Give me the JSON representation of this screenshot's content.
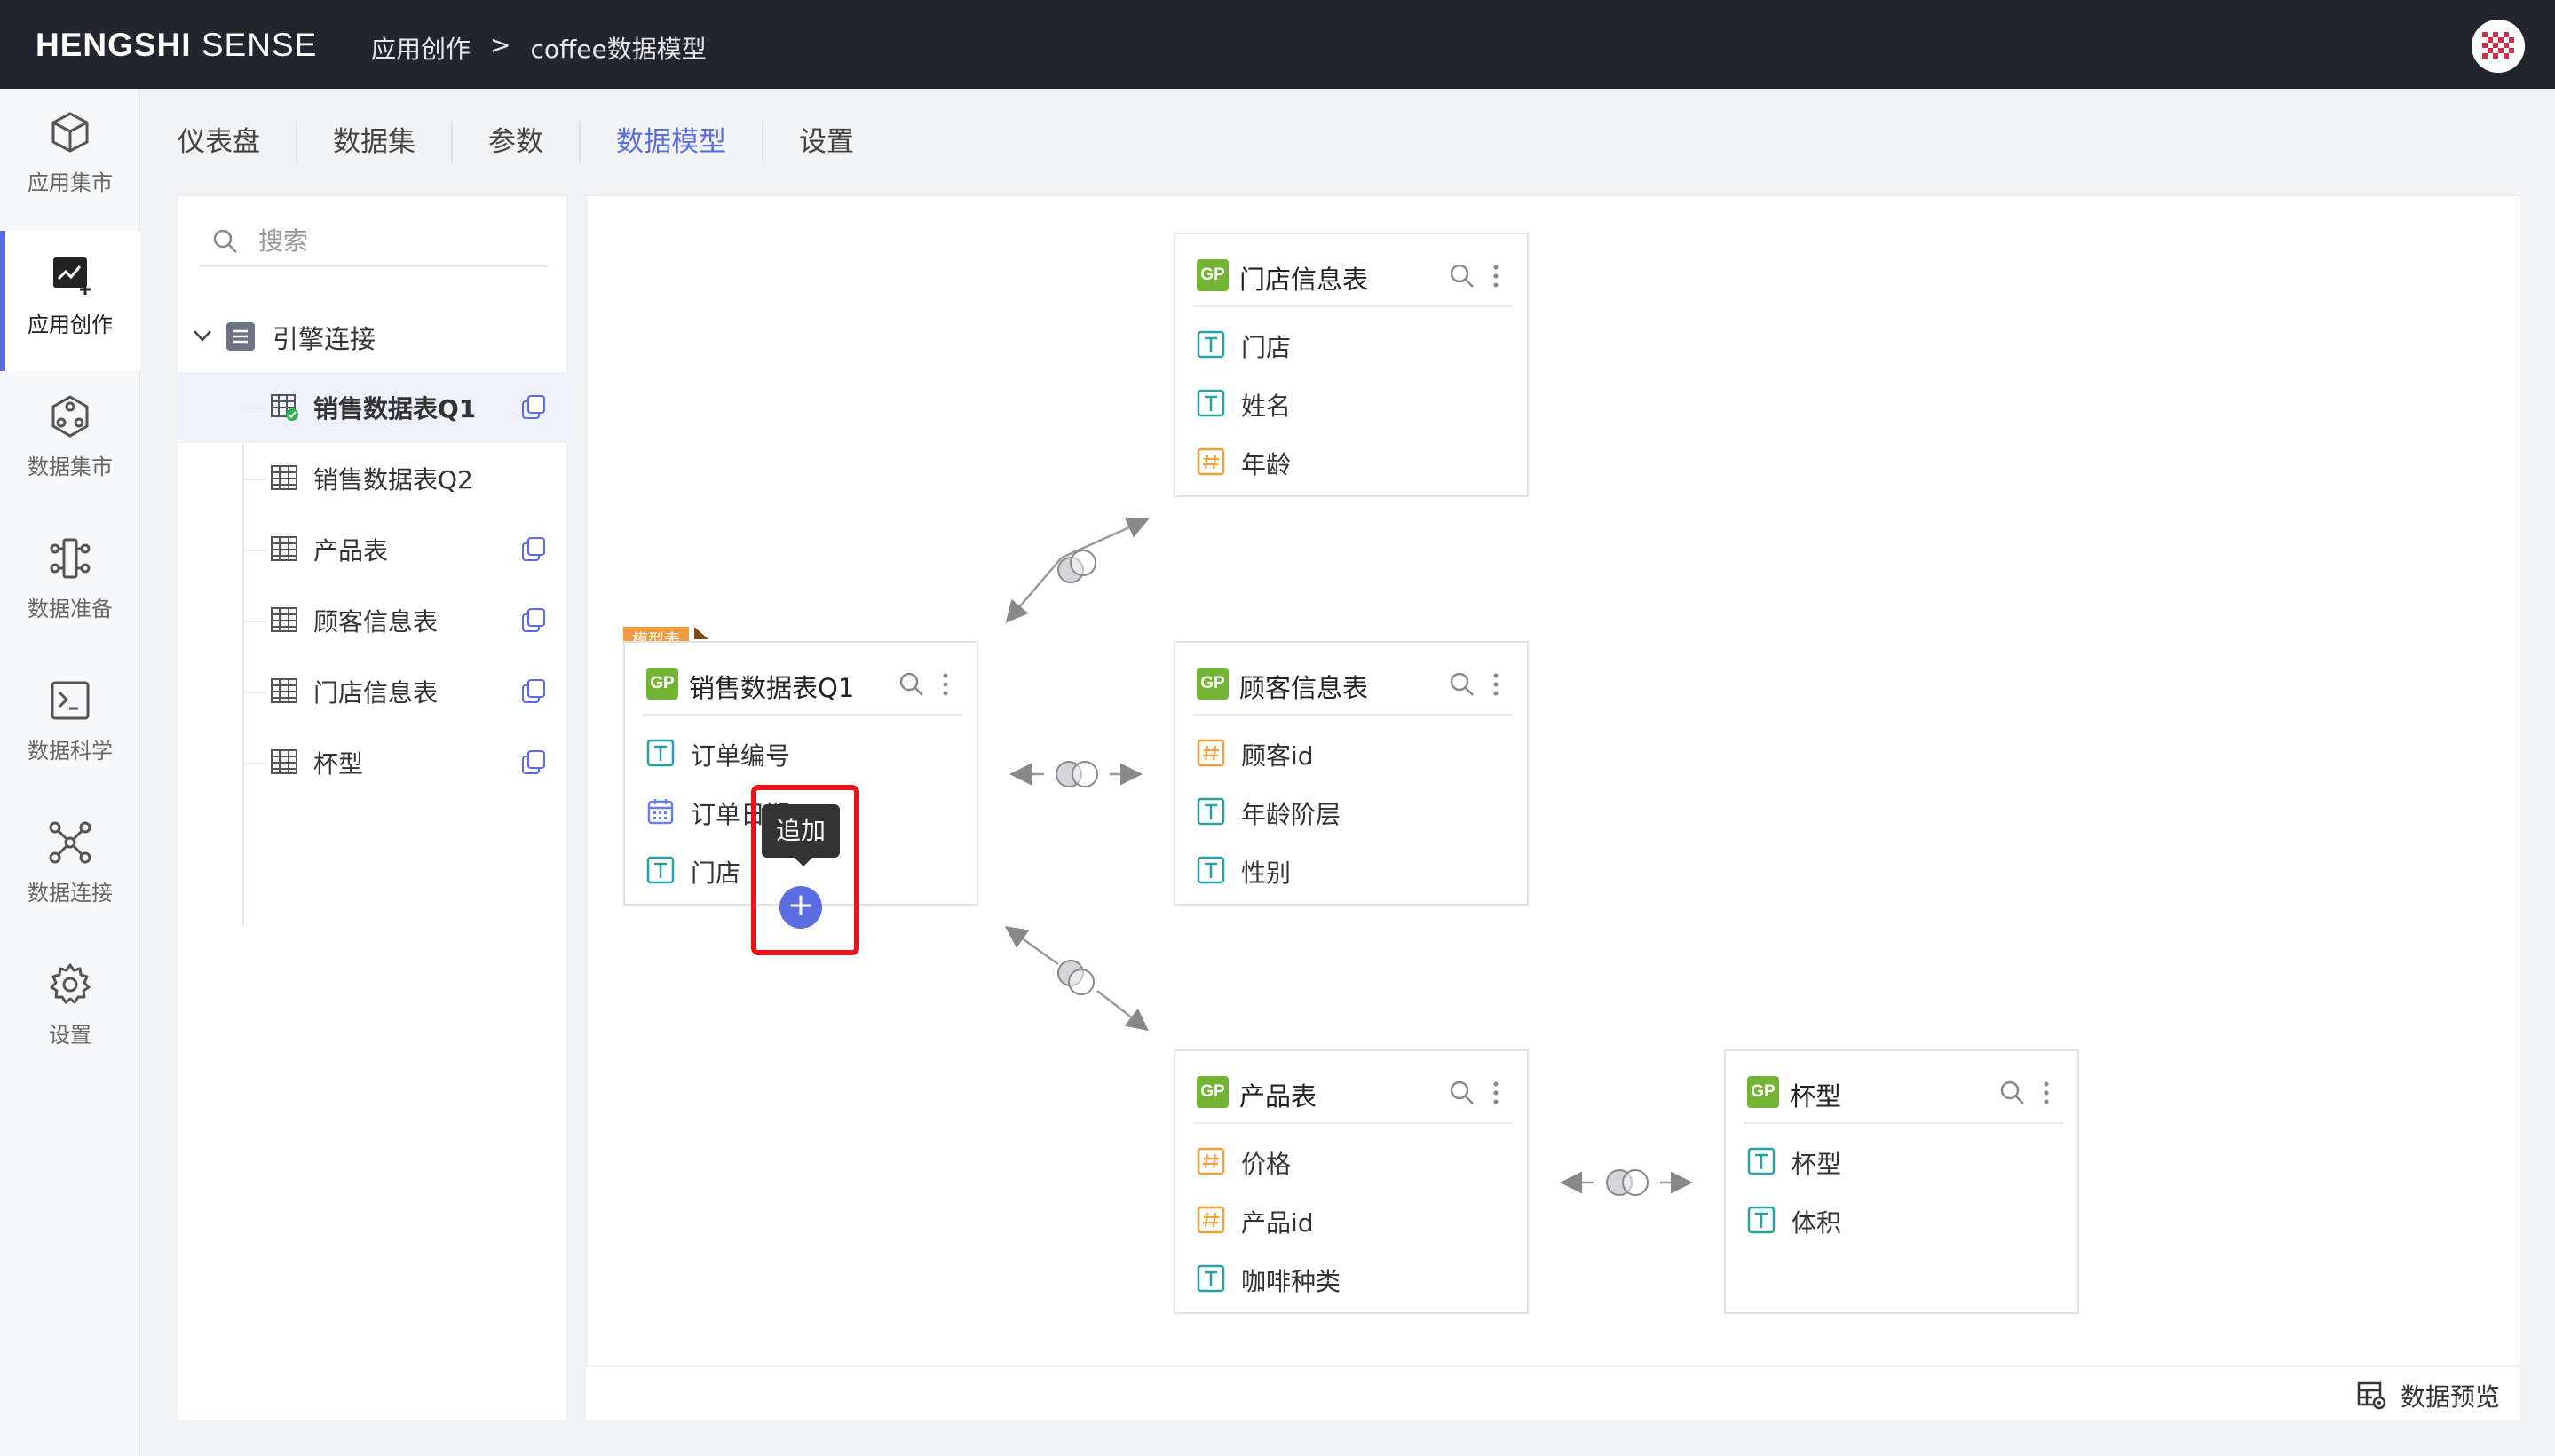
{
  "app": {
    "brand_bold": "HENGSHI",
    "brand_light": " SENSE",
    "breadcrumb": [
      "应用创作",
      ">",
      "coffee数据模型"
    ]
  },
  "leftnav": [
    {
      "label": "应用集市",
      "icon": "cube-icon"
    },
    {
      "label": "应用创作",
      "icon": "chart-create-icon",
      "active": true
    },
    {
      "label": "数据集市",
      "icon": "dataset-hex-icon"
    },
    {
      "label": "数据准备",
      "icon": "data-prep-icon"
    },
    {
      "label": "数据科学",
      "icon": "terminal-icon"
    },
    {
      "label": "数据连接",
      "icon": "network-icon"
    },
    {
      "label": "设置",
      "icon": "gear-icon"
    }
  ],
  "tabs": [
    {
      "label": "仪表盘"
    },
    {
      "label": "数据集"
    },
    {
      "label": "参数"
    },
    {
      "label": "数据模型",
      "active": true
    },
    {
      "label": "设置"
    }
  ],
  "sidebar": {
    "search_placeholder": "搜索",
    "root": "引擎连接",
    "items": [
      {
        "label": "销售数据表Q1",
        "selected": true,
        "copy": true
      },
      {
        "label": "销售数据表Q2",
        "copy": false
      },
      {
        "label": "产品表",
        "copy": true
      },
      {
        "label": "顾客信息表",
        "copy": true
      },
      {
        "label": "门店信息表",
        "copy": true
      },
      {
        "label": "杯型",
        "copy": true
      }
    ]
  },
  "model": {
    "model_tag": "模型表",
    "tooltip": "追加",
    "add_symbol": "+",
    "cards": {
      "sales": {
        "badge": "GP",
        "title": "销售数据表Q1",
        "fields": [
          {
            "type": "T",
            "name": "订单编号"
          },
          {
            "type": "date",
            "name": "订单日期"
          },
          {
            "type": "T",
            "name": "门店"
          }
        ]
      },
      "store": {
        "badge": "GP",
        "title": "门店信息表",
        "fields": [
          {
            "type": "T",
            "name": "门店"
          },
          {
            "type": "T",
            "name": "姓名"
          },
          {
            "type": "#",
            "name": "年龄"
          }
        ]
      },
      "customer": {
        "badge": "GP",
        "title": "顾客信息表",
        "fields": [
          {
            "type": "#",
            "name": "顾客id"
          },
          {
            "type": "T",
            "name": "年龄阶层"
          },
          {
            "type": "T",
            "name": "性别"
          }
        ]
      },
      "product": {
        "badge": "GP",
        "title": "产品表",
        "fields": [
          {
            "type": "#",
            "name": "价格"
          },
          {
            "type": "#",
            "name": "产品id"
          },
          {
            "type": "T",
            "name": "咖啡种类"
          }
        ]
      },
      "cup": {
        "badge": "GP",
        "title": "杯型",
        "fields": [
          {
            "type": "T",
            "name": "杯型"
          },
          {
            "type": "T",
            "name": "体积"
          }
        ]
      }
    }
  },
  "footer": {
    "preview_label": "数据预览"
  },
  "colors": {
    "accent": "#5a6de0",
    "gp_badge": "#73b434",
    "model_tag": "#f39c3e",
    "highlight": "#e8141b",
    "topbar": "#23252e"
  }
}
